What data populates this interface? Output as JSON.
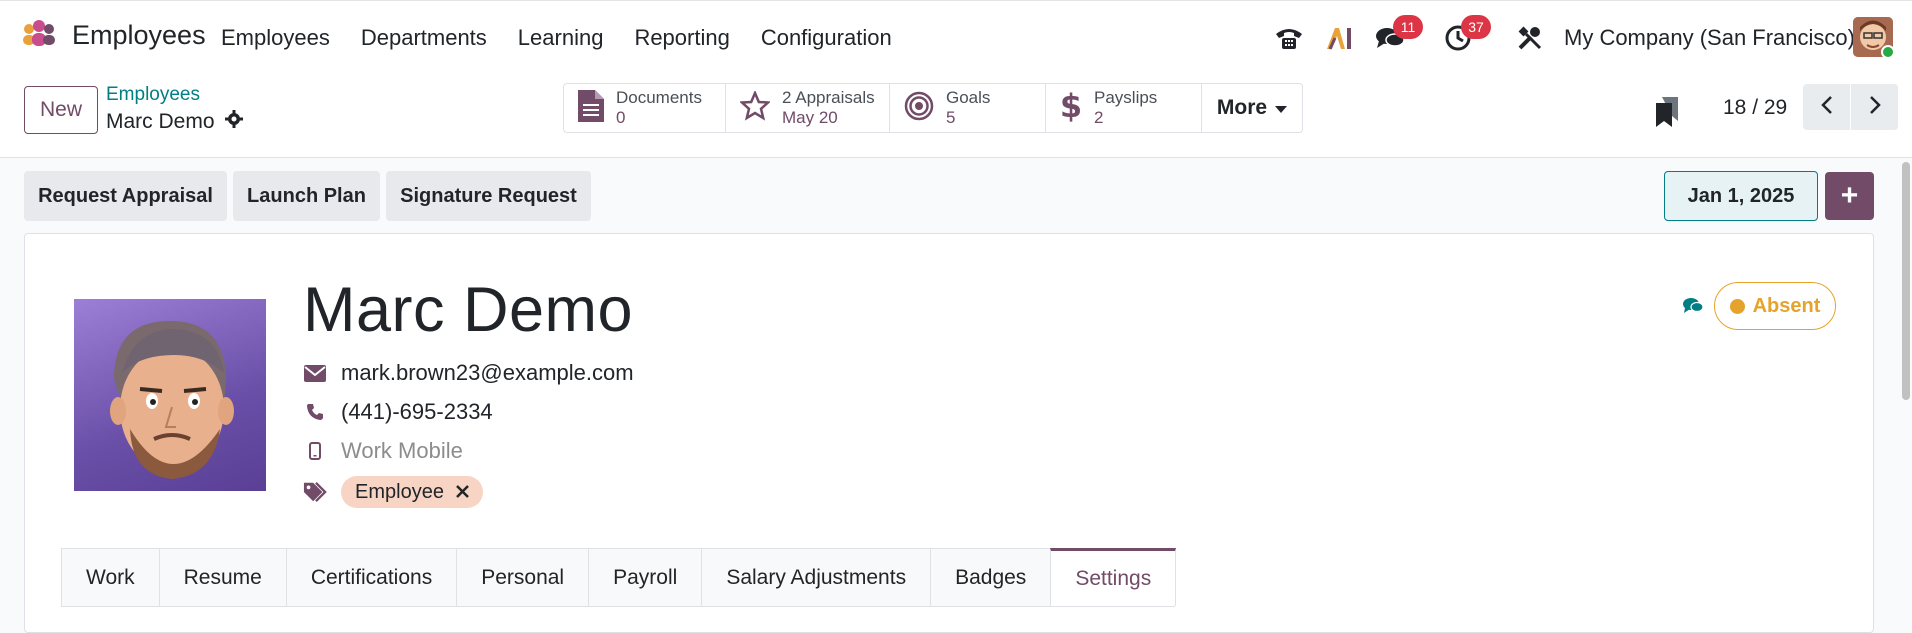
{
  "app": {
    "name": "Employees"
  },
  "nav": {
    "menu": [
      "Employees",
      "Departments",
      "Learning",
      "Reporting",
      "Configuration"
    ]
  },
  "systray": {
    "messages_count": "11",
    "activities_count": "37",
    "company": "My Company (San Francisco)"
  },
  "control": {
    "new_label": "New",
    "breadcrumb_parent": "Employees",
    "breadcrumb_current": "Marc Demo",
    "stats": [
      {
        "label": "Documents",
        "value": "0"
      },
      {
        "label": "2 Appraisals",
        "value": "May 20"
      },
      {
        "label": "Goals",
        "value": "5"
      },
      {
        "label": "Payslips",
        "value": "2"
      }
    ],
    "more_label": "More",
    "pager": "18 / 29"
  },
  "statusbar": {
    "buttons": [
      "Request Appraisal",
      "Launch Plan",
      "Signature Request"
    ],
    "date": "Jan 1, 2025",
    "plus": "+"
  },
  "employee": {
    "name": "Marc Demo",
    "email": "mark.brown23@example.com",
    "phone": "(441)-695-2334",
    "mobile_placeholder": "Work Mobile",
    "tag": "Employee",
    "status": "Absent"
  },
  "tabs": [
    "Work",
    "Resume",
    "Certifications",
    "Personal",
    "Payroll",
    "Salary Adjustments",
    "Badges",
    "Settings"
  ],
  "colors": {
    "brand": "#714b67",
    "teal": "#017e84",
    "badge": "#dc3545",
    "absent": "#e6a32b"
  }
}
